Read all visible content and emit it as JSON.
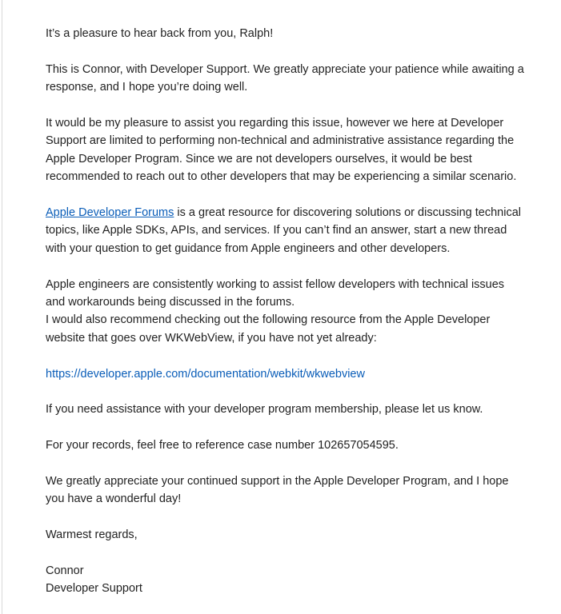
{
  "email": {
    "greeting": "It’s a pleasure to hear back from you, Ralph!",
    "intro": "This is Connor, with Developer Support. We greatly appreciate your patience while awaiting a response, and I hope you’re doing well.",
    "scope": "It would be my pleasure to assist you regarding this issue, however we here at Developer Support are limited to performing non-technical and administrative assistance regarding the Apple Developer Program. Since we are not developers ourselves, it would be best recommended to reach out to other developers that may be experiencing a similar scenario.",
    "forums_link_label": "Apple Developer Forums",
    "forums_text": " is a great resource for discovering solutions or discussing technical topics, like Apple SDKs, APIs, and services. If you can’t find an answer, start a new thread with your question to get guidance from Apple engineers and other developers.",
    "engineers": "Apple engineers are consistently working to assist fellow developers with technical issues and workarounds being discussed in the forums.",
    "recommend": "I would also recommend checking out the following resource from the Apple Developer website that goes over WKWebView, if you have not yet already:",
    "resource_link": "https://developer.apple.com/documentation/webkit/wkwebview",
    "membership": "If you need assistance with your developer program membership, please let us know.",
    "case_number": "For your records, feel free to reference case number 102657054595.",
    "closing": "We greatly appreciate your continued support in the Apple Developer Program, and I hope you have a wonderful day!",
    "signoff": "Warmest regards,",
    "sender_name": "Connor",
    "sender_team": "Developer Support"
  },
  "colors": {
    "text": "#222222",
    "link": "#0a5db8"
  }
}
